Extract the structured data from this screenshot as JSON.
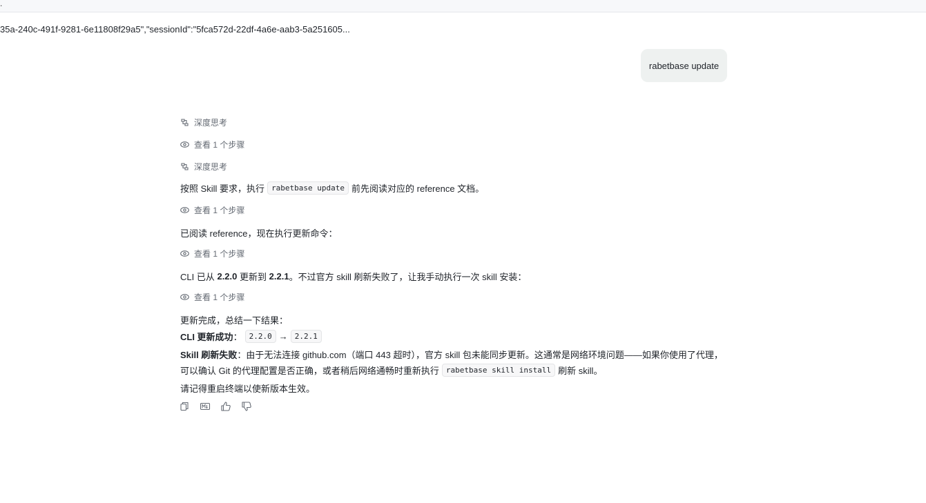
{
  "topbar": {
    "mark": "."
  },
  "session_line": "35a-240c-491f-9281-6e11808f29a5\",\"sessionId\":\"5fca572d-22df-4a6e-aab3-5a251605...",
  "user_message": "rabetbase update",
  "thinking_label": "深度思考",
  "steps_label": "查看 1 个步骤",
  "msg1": {
    "pre": "按照 Skill 要求，执行",
    "code": "rabetbase update",
    "post": "前先阅读对应的 reference 文档。"
  },
  "msg2": "已阅读 reference，现在执行更新命令：",
  "msg3": {
    "pre": "CLI 已从",
    "v1": "2.2.0",
    "mid": "更新到",
    "v2": "2.2.1",
    "post": "。不过官方 skill 刷新失败了，让我手动执行一次 skill 安装："
  },
  "msg4": "更新完成，总结一下结果：",
  "cli_result": {
    "label": "CLI 更新成功",
    "colon": "：",
    "from": "2.2.0",
    "arrow": "→",
    "to": "2.2.1"
  },
  "skill_result": {
    "label": "Skill 刷新失败",
    "line1": "：由于无法连接 github.com（端口 443 超时），官方 skill 包未能同步更新。这通常是网络环境问题——如果你使用了代理，",
    "line2_pre": "可以确认 Git 的代理配置是否正确，或者稍后网络通畅时重新执行",
    "line2_code": "rabetbase skill install",
    "line2_post": "刷新 skill。"
  },
  "restart_note": "请记得重启终端以使新版本生效。",
  "action_icons": [
    "copy-icon",
    "markdown-icon",
    "thumbs-up-icon",
    "thumbs-down-icon"
  ]
}
